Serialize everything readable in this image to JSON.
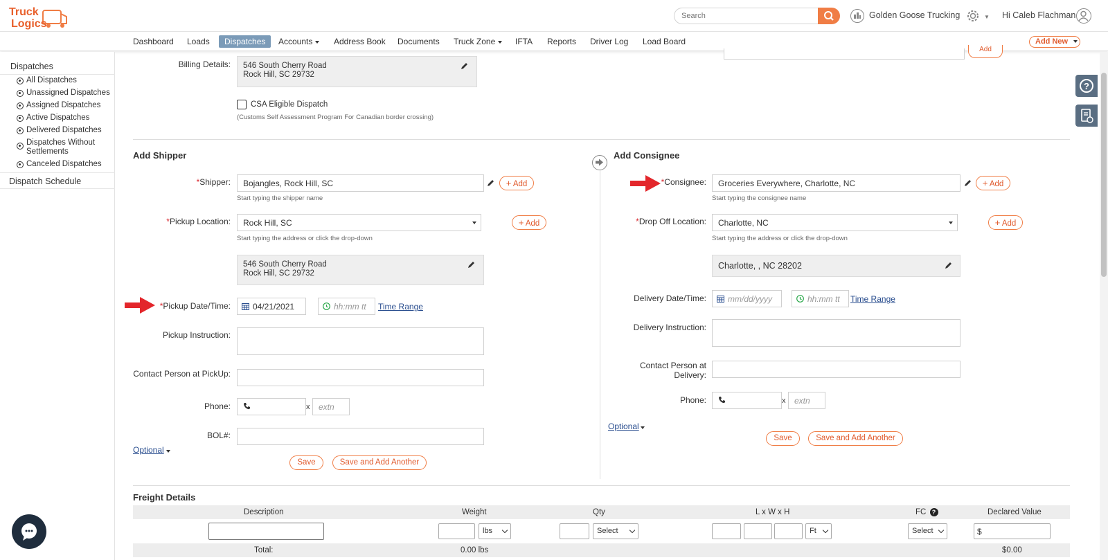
{
  "brand": {
    "logo_text_line1": "Truck",
    "logo_text_line2": "Logics",
    "color_primary": "#f07d45",
    "color_nav_active": "#7b9bb8"
  },
  "header": {
    "search_placeholder": "Search",
    "company_name": "Golden Goose Trucking",
    "greeting": "Hi Caleb Flachman"
  },
  "nav": {
    "items": [
      "Dashboard",
      "Loads",
      "Dispatches",
      "Accounts",
      "Address Book",
      "Documents",
      "Truck Zone",
      "IFTA",
      "Reports",
      "Driver Log",
      "Load Board"
    ],
    "active": "Dispatches",
    "add_new": "Add New"
  },
  "sidebar": {
    "section_title": "Dispatches",
    "items": [
      "All Dispatches",
      "Unassigned Dispatches",
      "Assigned Dispatches",
      "Active Dispatches",
      "Delivered Dispatches",
      "Dispatches Without Settlements",
      "Canceled Dispatches"
    ],
    "schedule": "Dispatch Schedule"
  },
  "billing": {
    "label": "Billing Details:",
    "address_line1": "546 South Cherry Road",
    "address_line2": "Rock Hill, SC 29732",
    "top_right_add": "Add"
  },
  "csa": {
    "label": "CSA Eligible Dispatch",
    "note": "(Customs Self Assessment Program For Canadian border crossing)"
  },
  "shipper": {
    "title": "Add Shipper",
    "shipper_label": "Shipper:",
    "shipper_value": "Bojangles, Rock Hill, SC",
    "shipper_hint": "Start typing the shipper name",
    "add_label": "Add",
    "pickup_location_label": "Pickup Location:",
    "pickup_location_value": "Rock Hill, SC",
    "location_hint": "Start typing the address or click the drop-down",
    "address_line1": "546 South Cherry Road",
    "address_line2": "Rock Hill, SC 29732",
    "pickup_date_label": "Pickup Date/Time:",
    "pickup_date_value": "04/21/2021",
    "time_placeholder": "hh:mm tt",
    "time_range": "Time Range",
    "instruction_label": "Pickup Instruction:",
    "contact_label": "Contact Person at PickUp:",
    "phone_label": "Phone:",
    "x": "x",
    "extn_placeholder": "extn",
    "bol_label": "BOL#:",
    "optional": "Optional",
    "save": "Save",
    "save_add_another": "Save and Add Another"
  },
  "consignee": {
    "title": "Add Consignee",
    "consignee_label": "Consignee:",
    "consignee_value": "Groceries Everywhere, Charlotte, NC",
    "consignee_hint": "Start typing the consignee name",
    "add_label": "Add",
    "dropoff_label": "Drop Off Location:",
    "dropoff_value": "Charlotte, NC",
    "location_hint": "Start typing the address or click the drop-down",
    "address_line1": "Charlotte, , NC 28202",
    "delivery_date_label": "Delivery Date/Time:",
    "date_placeholder": "mm/dd/yyyy",
    "time_placeholder": "hh:mm tt",
    "time_range": "Time Range",
    "instruction_label": "Delivery Instruction:",
    "contact_label_line1": "Contact Person at",
    "contact_label_line2": "Delivery:",
    "phone_label": "Phone:",
    "x": "x",
    "extn_placeholder": "extn",
    "optional": "Optional",
    "save": "Save",
    "save_add_another": "Save and Add Another"
  },
  "freight": {
    "title": "Freight Details",
    "columns": [
      "Description",
      "Weight",
      "Qty",
      "L x W x H",
      "FC",
      "Declared Value"
    ],
    "weight_unit": "lbs",
    "qty_select": "Select",
    "dim_unit": "Ft",
    "fc_select": "Select",
    "value_prefix": "$",
    "total_label": "Total:",
    "total_weight": "0.00 lbs",
    "total_value": "$0.00"
  }
}
